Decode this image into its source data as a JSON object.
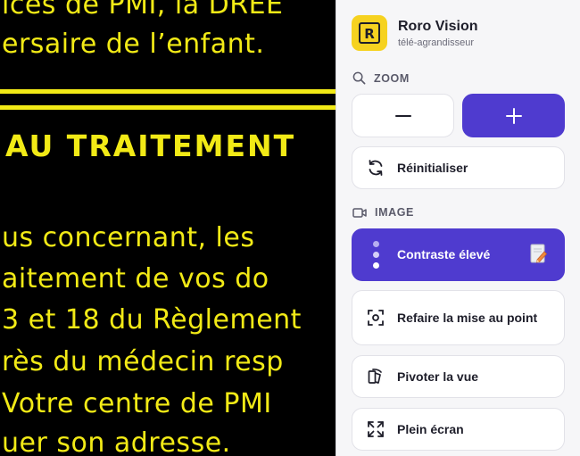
{
  "document": {
    "lines": [
      "ices de PMI, la DREE",
      "ersaire de l’enfant.",
      "AU TRAITEMENT",
      "us concernant, les",
      "aitement de vos do",
      "3 et 18 du Règlement",
      "rès du médecin resp",
      "Votre centre de PMI",
      "uer son adresse."
    ]
  },
  "app": {
    "name": "Roro Vision",
    "subtitle": "télé-agrandisseur",
    "logo_letter": "R"
  },
  "zoom": {
    "title": "ZOOM",
    "zoom_out_label": "−",
    "zoom_in_label": "+"
  },
  "reset": {
    "label": "Réinitialiser"
  },
  "image": {
    "title": "IMAGE",
    "items": [
      {
        "label": "Contraste élevé",
        "icon": "dots-contrast-icon",
        "active": true
      },
      {
        "label": "Refaire la mise au point",
        "icon": "focus-icon"
      },
      {
        "label": "Pivoter la vue",
        "icon": "rotate-view-icon"
      },
      {
        "label": "Plein écran",
        "icon": "fullscreen-icon"
      }
    ]
  },
  "colors": {
    "accent": "#4f3bcf",
    "contrast_fg": "#f2ea16",
    "contrast_bg": "#000000",
    "logo": "#f6d220"
  }
}
